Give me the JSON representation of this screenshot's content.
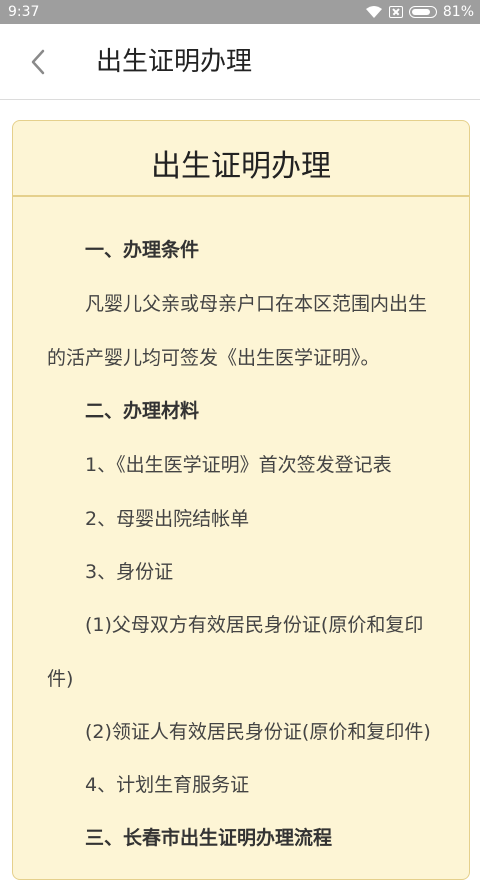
{
  "status_bar": {
    "time": "9:37",
    "battery": "81%"
  },
  "nav": {
    "title": "出生证明办理"
  },
  "card": {
    "title": "出生证明办理",
    "lines": [
      "一、办理条件",
      "凡婴儿父亲或母亲户口在本区范围内出生",
      "的活产婴儿均可签发《出生医学证明》。",
      "二、办理材料",
      "1、《出生医学证明》首次签发登记表",
      "2、母婴出院结帐单",
      "3、身份证",
      "(1)父母双方有效居民身份证(原价和复印",
      "件)",
      "(2)领证人有效居民身份证(原价和复印件)",
      "4、计划生育服务证",
      "三、长春市出生证明办理流程"
    ]
  }
}
